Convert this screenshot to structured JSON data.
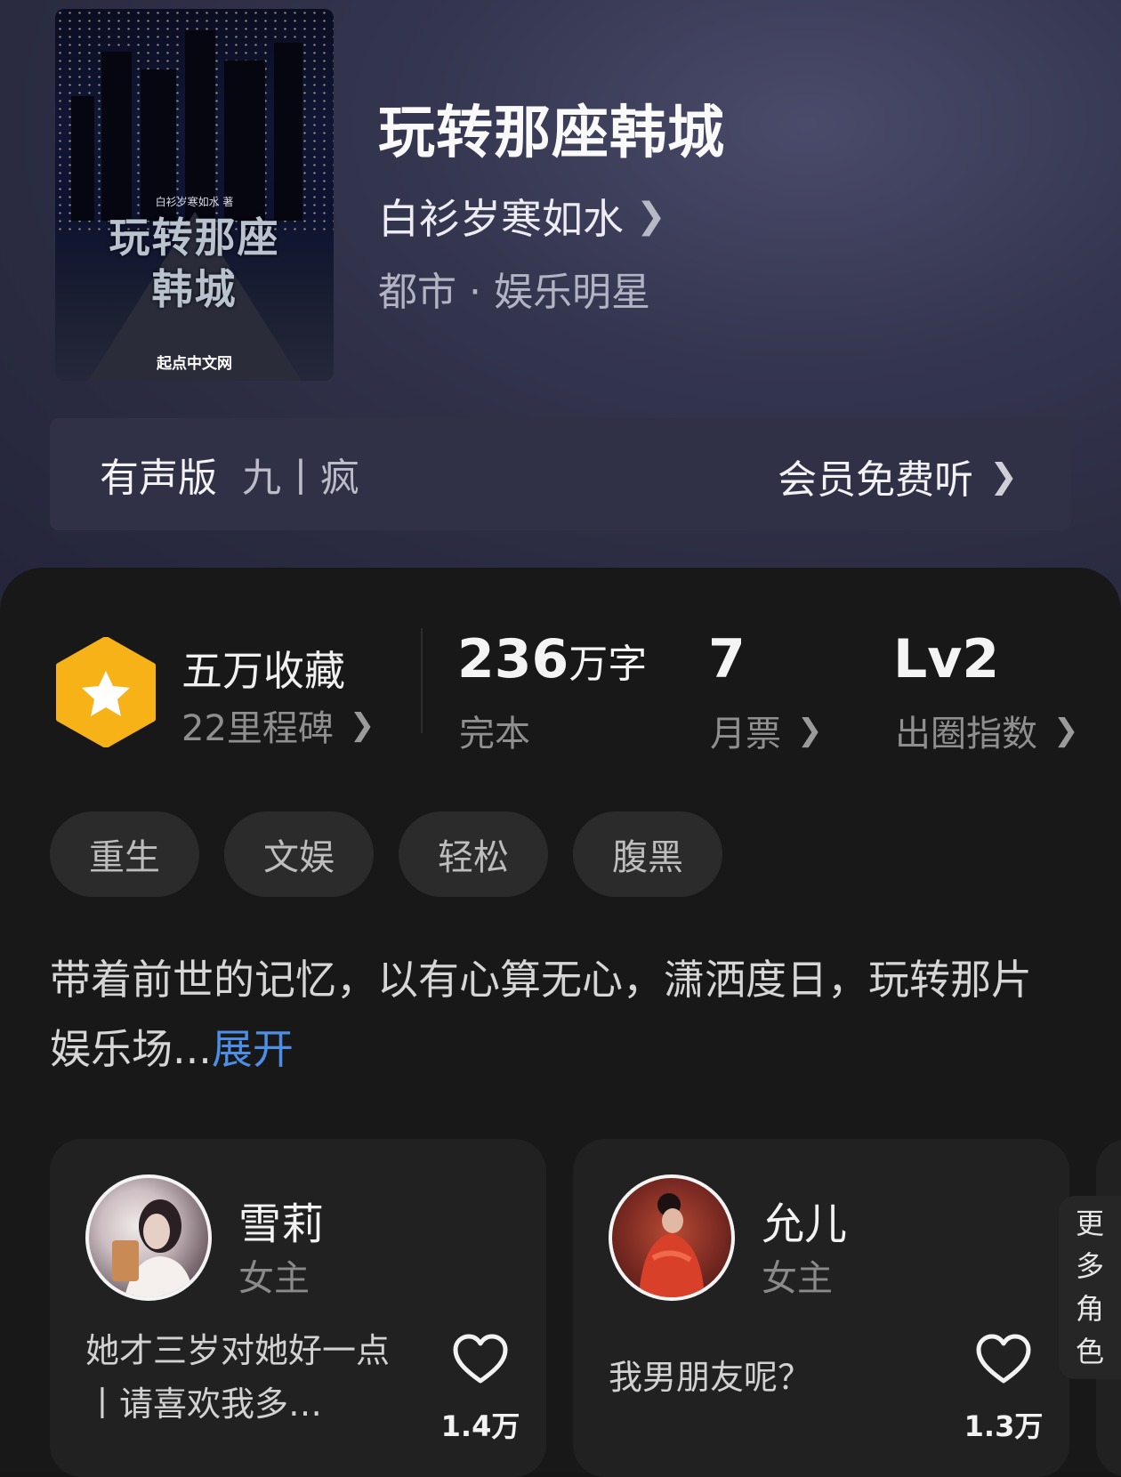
{
  "book": {
    "title": "玩转那座韩城",
    "author": "白衫岁寒如水",
    "genre": "都市 · 娱乐明星",
    "cover": {
      "author_line": "白衫岁寒如水 著",
      "title_line1": "玩转那座",
      "title_line2": "韩城",
      "publisher": "起点中文网"
    }
  },
  "audio": {
    "label": "有声版",
    "narrator": "九丨疯",
    "cta": "会员免费听"
  },
  "stats": {
    "collection": {
      "title": "五万收藏",
      "sub": "22里程碑"
    },
    "words": {
      "number": "236",
      "unit": "万字",
      "sub": "完本"
    },
    "votes": {
      "number": "7",
      "sub": "月票"
    },
    "influence": {
      "number": "Lv2",
      "sub": "出圈指数"
    }
  },
  "tags": [
    "重生",
    "文娱",
    "轻松",
    "腹黑"
  ],
  "synopsis": {
    "text": "带着前世的记忆，以有心算无心，潇洒度日，玩转那片娱乐场...",
    "expand": "展开"
  },
  "characters": [
    {
      "name": "雪莉",
      "role": "女主",
      "quote": "她才三岁对她好一点丨请喜欢我多…",
      "likes": "1.4万"
    },
    {
      "name": "允儿",
      "role": "女主",
      "quote": "我男朋友呢？",
      "likes": "1.3万"
    }
  ],
  "more_roles": [
    "更",
    "多",
    "角",
    "色"
  ],
  "icons": {
    "author_chevron": "chevron-right-icon",
    "badge": "star-hexagon-icon",
    "like": "heart-outline-icon"
  },
  "colors": {
    "hero_bg": "#2e2f46",
    "panel_bg": "#181818",
    "badge": "#f7b218",
    "link": "#4d8fe6"
  }
}
